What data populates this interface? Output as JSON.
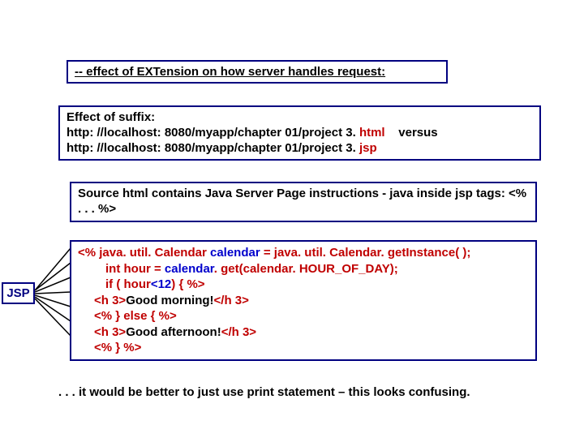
{
  "title": "-- effect of EXTension on how server handles request:",
  "suffix": {
    "heading": "Effect of suffix:",
    "url1_pre": "http: //localhost: 8080/myapp/chapter 01/project 3. ",
    "url1_ext": "html",
    "versus": "versus",
    "url2_pre": "http: //localhost: 8080/myapp/chapter 01/project 3. ",
    "url2_ext": "jsp"
  },
  "source_note": "Source html contains Java Server Page instructions - java inside jsp tags:   <%  . . .   %>",
  "jsp_label": "JSP",
  "code": {
    "l1a": "<% java. util. Calendar ",
    "l1b": "calendar",
    "l1c": " = java. util. Calendar. getInstance( );",
    "l2a": "int hour = ",
    "l2b": "calendar",
    "l2c": ". get(calendar. HOUR_OF_DAY);",
    "l3a": "if ( hour",
    "l3b": "<12",
    "l3c": ") { %>",
    "l4a": "<h 3>",
    "l4b": "Good morning!",
    "l4c": "</h 3>",
    "l5": "<% } else { %>",
    "l6a": "<h 3>",
    "l6b": "Good afternoon!",
    "l6c": "</h 3>",
    "l7": "<% } %>"
  },
  "footer": ". . . it would be better to just use print statement – this looks confusing."
}
